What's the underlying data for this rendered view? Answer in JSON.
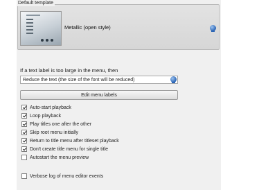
{
  "template_group": {
    "legend": "Default template",
    "selected_template": "Metallic (open style)",
    "picker_icon": "globe-icon"
  },
  "text_label": {
    "prompt": "If a text label is too large in the menu, then",
    "selected_option": "Reduce the text (the size of the font will be reduced)",
    "dropdown_icon": "globe-icon"
  },
  "edit_button_label": "Edit menu labels",
  "options": [
    {
      "label": "Auto-start playback",
      "checked": true
    },
    {
      "label": "Loop playback",
      "checked": true
    },
    {
      "label": "Play titles one after the other",
      "checked": true
    },
    {
      "label": "Skip root menu initially",
      "checked": true
    },
    {
      "label": "Return to title menu after titleset playback",
      "checked": true
    },
    {
      "label": "Don't create title menu for single title",
      "checked": true
    },
    {
      "label": "Autostart the menu preview",
      "checked": false
    }
  ],
  "verbose_option": {
    "label": "Verbose log of menu editor events",
    "checked": false
  }
}
